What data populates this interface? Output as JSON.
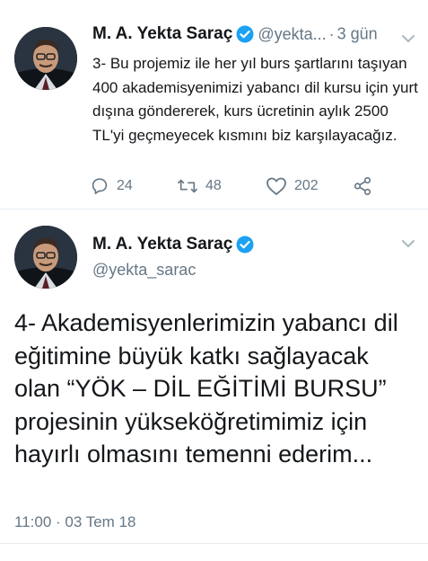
{
  "tweet1": {
    "author_name": "M. A. Yekta Saraç",
    "author_handle": "@yekta...",
    "separator": "·",
    "time_ago": "3 gün",
    "text": "3- Bu projemiz ile her yıl burs şartlarını taşıyan 400 akademisyenimizi yabancı dil kursu için yurt dışına göndererek, kurs ücretinin aylık 2500 TL'yi geçmeyecek kısmını biz karşılayacağız.",
    "replies": "24",
    "retweets": "48",
    "likes": "202"
  },
  "tweet2": {
    "author_name": "M. A. Yekta Saraç",
    "author_handle": "@yekta_sarac",
    "text": "4- Akademisyenlerimizin yabancı dil eğitimine büyük katkı sağlayacak olan “YÖK – DİL EĞİTİMİ BURSU” projesinin yükseköğretimimiz için hayırlı olmasını temenni ederim...",
    "timestamp": "11:00 · 03 Tem 18"
  },
  "colors": {
    "text_primary": "#14171a",
    "text_secondary": "#657786",
    "verified_blue": "#1da1f2",
    "divider": "#e6ecf0"
  },
  "icons": {
    "reply": "reply-icon",
    "retweet": "retweet-icon",
    "like": "heart-icon",
    "share": "share-icon",
    "verified": "verified-badge-icon",
    "menu": "chevron-down-icon"
  }
}
